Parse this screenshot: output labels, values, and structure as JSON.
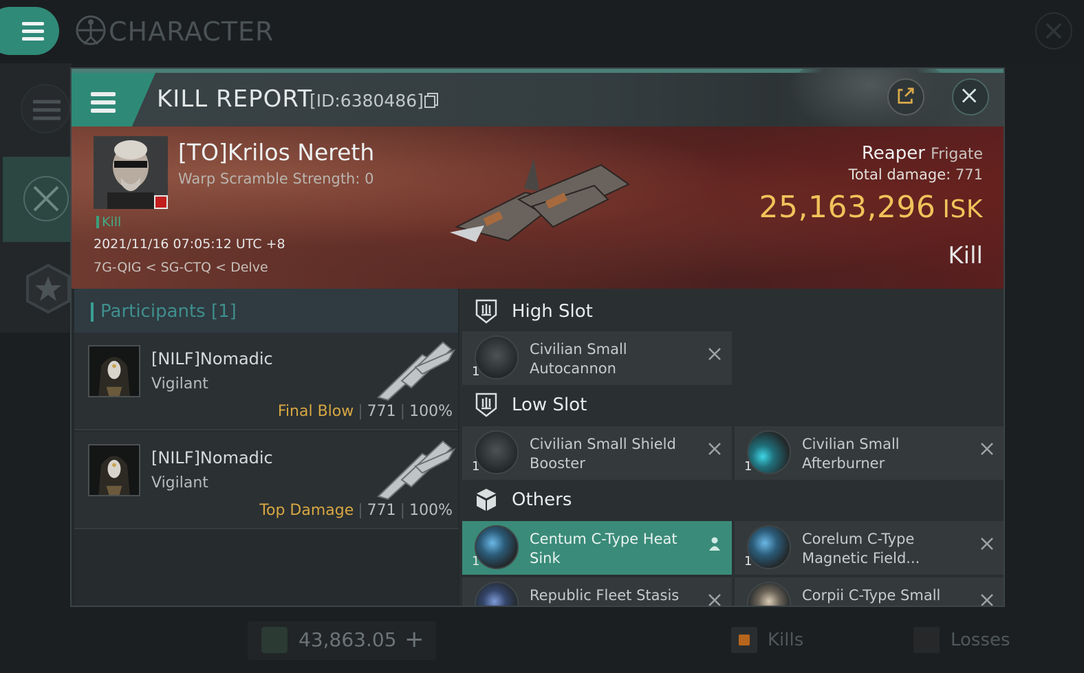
{
  "app": {
    "title": "CHARACTER"
  },
  "kill_report": {
    "title": "KILL REPORT",
    "id": "[ID:6380486]"
  },
  "victim": {
    "name": "[TO]Krilos Nereth",
    "scramble": "Warp Scramble Strength: 0",
    "tag": "Kill",
    "datetime": "2021/11/16 07:05:12 UTC +8",
    "location": "7G-QIG < SG-CTQ < Delve",
    "ship": "Reaper",
    "ship_class": "Frigate",
    "total_damage_label": "Total damage:",
    "total_damage": "771",
    "isk_value": "25,163,296",
    "isk_unit": "ISK",
    "status": "Kill"
  },
  "participants": {
    "title": "Participants [1]",
    "rows": [
      {
        "name": "[NILF]Nomadic",
        "ship": "Vigilant",
        "tag": "Final Blow",
        "damage": "771",
        "percent": "100%"
      },
      {
        "name": "[NILF]Nomadic",
        "ship": "Vigilant",
        "tag": "Top Damage",
        "damage": "771",
        "percent": "100%"
      }
    ]
  },
  "slots": {
    "high": {
      "label": "High Slot",
      "items": [
        {
          "name": "Civilian Small Autocannon",
          "qty": "1"
        }
      ]
    },
    "low": {
      "label": "Low Slot",
      "items": [
        {
          "name": "Civilian Small Shield Booster",
          "qty": "1"
        },
        {
          "name": "Civilian Small Afterburner",
          "qty": "1"
        }
      ]
    },
    "others": {
      "label": "Others",
      "items": [
        {
          "name": "Centum C-Type Heat Sink",
          "qty": "1"
        },
        {
          "name": "Corelum C-Type Magnetic Field...",
          "qty": "1"
        },
        {
          "name": "Republic Fleet Stasis",
          "qty": ""
        },
        {
          "name": "Corpii C-Type Small",
          "qty": ""
        }
      ]
    }
  },
  "bottom": {
    "value": "43,863.05",
    "plus": "+",
    "kills_label": "Kills",
    "losses_label": "Losses"
  },
  "colors": {
    "accent": "#2e8a77",
    "isk": "#f0c35a",
    "final_blow": "#d7a743",
    "kill_tag": "#3fae88"
  },
  "icons": {
    "menu": "hamburger-icon",
    "character": "vitruvian-man-icon",
    "copy": "copy-icon",
    "share": "share-icon",
    "close": "close-icon",
    "high_slot": "high-slot-icon",
    "low_slot": "low-slot-icon",
    "others": "cargo-box-icon",
    "remove": "remove-x-icon",
    "owner": "person-icon"
  }
}
